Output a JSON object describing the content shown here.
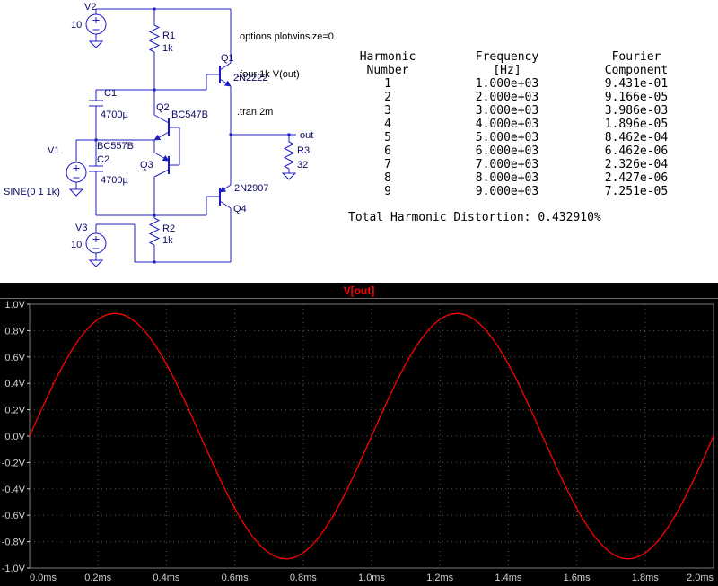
{
  "schematic": {
    "directives": [
      ".options plotwinsize=0",
      ".four 1k V(out)",
      ".tran 2m"
    ],
    "v2": {
      "name": "V2",
      "value": "10"
    },
    "r1": {
      "name": "R1",
      "value": "1k"
    },
    "q1": {
      "name": "Q1",
      "type": "2N2222"
    },
    "c1": {
      "name": "C1",
      "value": "4700µ"
    },
    "q2": {
      "name": "Q2",
      "type": "BC547B"
    },
    "v1": {
      "name": "V1",
      "value": "SINE(0 1 1k)"
    },
    "q3": {
      "name": "Q3",
      "type": "BC557B"
    },
    "c2": {
      "name": "C2",
      "value": "4700µ"
    },
    "r2": {
      "name": "R2",
      "value": "1k"
    },
    "q4": {
      "name": "Q4",
      "type": "2N2907"
    },
    "v3": {
      "name": "V3",
      "value": "10"
    },
    "r3": {
      "name": "R3",
      "value": "32"
    },
    "out_label": "out"
  },
  "fourier": {
    "header": {
      "col1a": "Harmonic",
      "col1b": "Number",
      "col2a": "Frequency",
      "col2b": "[Hz]",
      "col3a": "Fourier",
      "col3b": "Component"
    },
    "rows": [
      [
        "1",
        "1.000e+03",
        "9.431e-01"
      ],
      [
        "2",
        "2.000e+03",
        "9.166e-05"
      ],
      [
        "3",
        "3.000e+03",
        "3.986e-03"
      ],
      [
        "4",
        "4.000e+03",
        "1.896e-05"
      ],
      [
        "5",
        "5.000e+03",
        "8.462e-04"
      ],
      [
        "6",
        "6.000e+03",
        "6.462e-06"
      ],
      [
        "7",
        "7.000e+03",
        "2.326e-04"
      ],
      [
        "8",
        "8.000e+03",
        "2.427e-06"
      ],
      [
        "9",
        "9.000e+03",
        "7.251e-05"
      ]
    ],
    "thd": "Total Harmonic Distortion: 0.432910%"
  },
  "chart_data": {
    "type": "line",
    "title": "V[out]",
    "x_ticks": [
      "0.0ms",
      "0.2ms",
      "0.4ms",
      "0.6ms",
      "0.8ms",
      "1.0ms",
      "1.2ms",
      "1.4ms",
      "1.6ms",
      "1.8ms",
      "2.0ms"
    ],
    "y_ticks": [
      "1.0V",
      "0.8V",
      "0.6V",
      "0.4V",
      "0.2V",
      "0.0V",
      "-0.2V",
      "-0.4V",
      "-0.6V",
      "-0.8V",
      "-1.0V"
    ],
    "xlim_ms": [
      0,
      2
    ],
    "ylim_v": [
      -1,
      1
    ],
    "grid": true,
    "background": "#000000",
    "label_color": "#cfcfcf",
    "grid_color": "#575757",
    "series": [
      {
        "name": "V[out]",
        "shape": "sine",
        "amplitude_v": 0.93,
        "frequency_hz": 1000,
        "phase_deg": 0,
        "offset_v": 0,
        "color": "#ff0000"
      }
    ]
  }
}
